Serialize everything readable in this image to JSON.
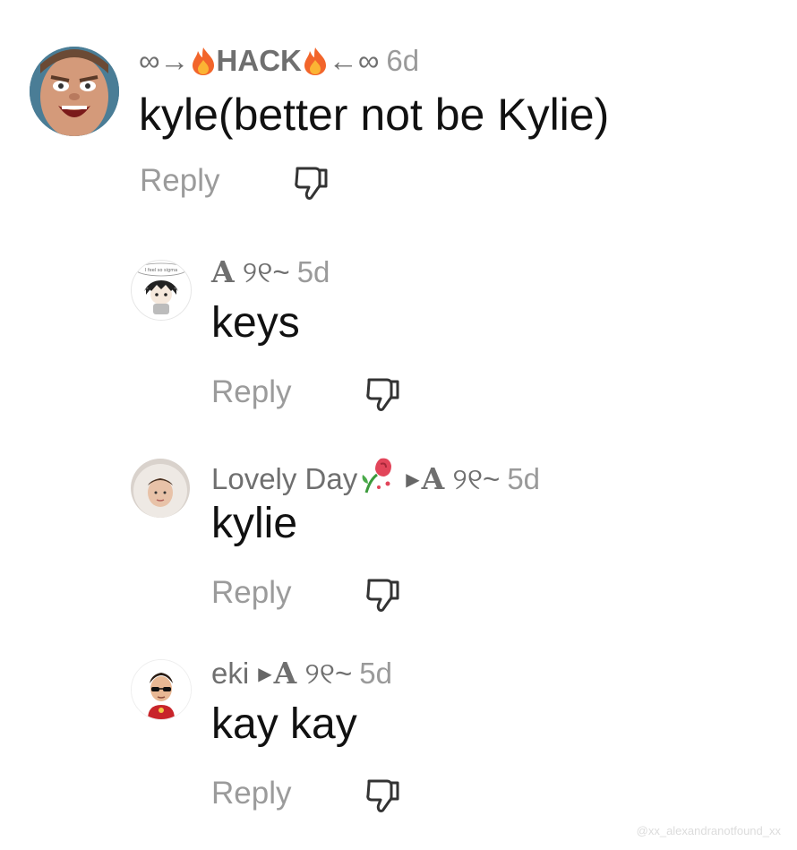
{
  "comments": [
    {
      "username_prefix": "∞→",
      "username_core": "HACK",
      "username_suffix": "←∞",
      "time": "6d",
      "text": "kyle(better not be Kylie)",
      "reply_label": "Reply"
    },
    {
      "username_a": "A",
      "username_rest": " ୨୧~",
      "time": "5d",
      "text": "keys",
      "reply_label": "Reply"
    },
    {
      "username": "Lovely Day",
      "reply_to_a": "A",
      "reply_to_rest": " ୨୧~",
      "time": "5d",
      "text": "kylie",
      "reply_label": "Reply"
    },
    {
      "username": "eki",
      "reply_to_a": "A",
      "reply_to_rest": " ୨୧~",
      "time": "5d",
      "text": "kay kay",
      "reply_label": "Reply"
    }
  ],
  "avatar_bubble_text": "I feel so sigma",
  "watermark": "@xx_alexandranotfound_xx",
  "colors": {
    "reply_text": "#9b9b9b",
    "meta_text": "#8a8a8a",
    "body_text": "#111111"
  }
}
